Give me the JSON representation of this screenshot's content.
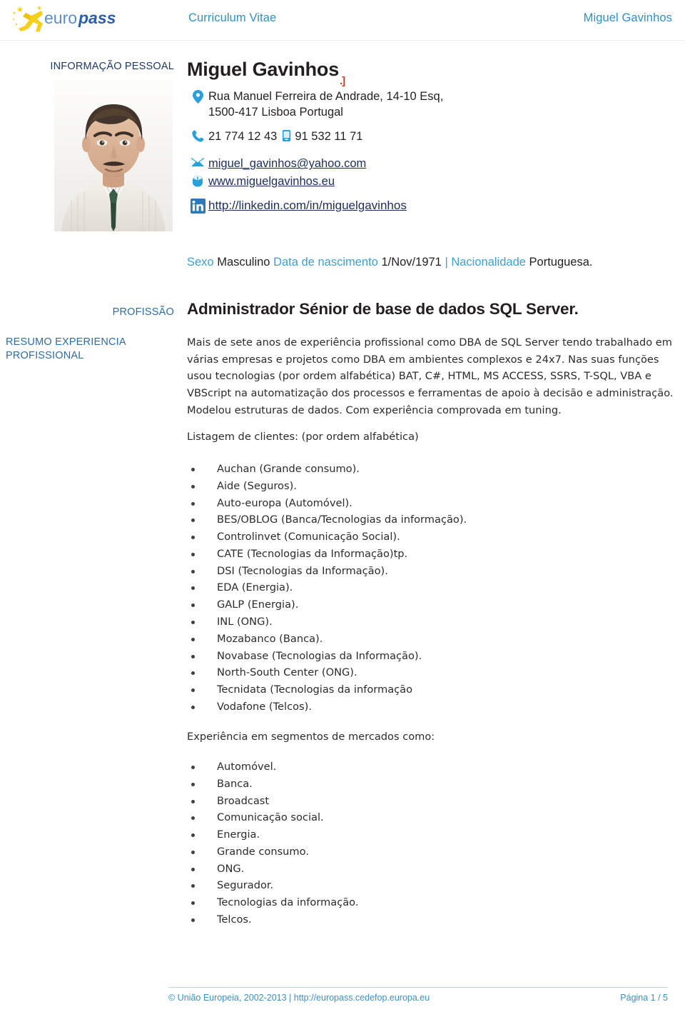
{
  "header": {
    "logo_text": "europass",
    "document_type": "Curriculum Vitae",
    "person_name": "Miguel Gavinhos"
  },
  "sidebar": {
    "personal_info_label": "INFORMAÇÃO PESSOAL",
    "profession_label": "PROFISSÃO",
    "summary_label": "RESUMO EXPERIENCIA PROFISSIONAL"
  },
  "personal": {
    "full_name": "Miguel Gavinhos",
    "red_mark": ".]",
    "address_line1": "Rua Manuel Ferreira de Andrade, 14-10 Esq,",
    "address_line2": "1500-417 Lisboa  Portugal",
    "phone_landline": "21 774 12 43",
    "phone_mobile": "91 532 11 71",
    "email": "miguel_gavinhos@yahoo.com",
    "website": "www.miguelgavinhos.eu",
    "linkedin": "http://linkedin.com/in/miguelgavinhos",
    "meta": {
      "sex_label": "Sexo",
      "sex_value": "Masculino",
      "birth_label": "Data de nascimento",
      "birth_value": "1/Nov/1971",
      "separator": "|",
      "nationality_label": "Nacionalidade",
      "nationality_value": "Portuguesa."
    }
  },
  "profession": {
    "title": "Administrador Sénior de base de dados SQL Server."
  },
  "summary": {
    "paragraph": "Mais de sete anos de experiência profissional como DBA de SQL Server tendo trabalhado em várias empresas e projetos como DBA em ambientes complexos e 24x7. Nas suas funções usou tecnologias (por ordem alfabética) BAT, C#, HTML, MS ACCESS, SSRS, T-SQL, VBA e VBScript na automatização dos processos e ferramentas de apoio à decisão e administração. Modelou estruturas de dados. Com experiência comprovada em tuning.",
    "clients_heading": "Listagem de clientes: (por ordem alfabética)",
    "clients": [
      "Auchan (Grande consumo).",
      "Aide (Seguros).",
      "Auto-europa (Automóvel).",
      "BES/OBLOG (Banca/Tecnologias da informação).",
      "Controlinvet (Comunicação Social).",
      "CATE (Tecnologias da Informação)tp.",
      "DSI (Tecnologias da Informação).",
      "EDA (Energia).",
      "GALP (Energia).",
      "INL (ONG).",
      "Mozabanco (Banca).",
      "Novabase (Tecnologias da Informação).",
      "North-South Center (ONG).",
      "Tecnidata (Tecnologias da informação",
      "Vodafone (Telcos)."
    ],
    "markets_heading": "Experiência em segmentos de mercados como:",
    "markets": [
      "Automóvel.",
      "Banca.",
      "Broadcast",
      "Comunicação social.",
      "Energia.",
      "Grande consumo.",
      "ONG.",
      "Segurador.",
      "Tecnologias da informação.",
      "Telcos."
    ]
  },
  "footer": {
    "copyright": "© União Europeia, 2002-2013 | http://europass.cedefop.europa.eu",
    "page_number": "Página 1 / 5"
  },
  "colors": {
    "accent_blue": "#2e93c7",
    "label_navy": "#1f3864",
    "link_navy": "#1c2d5e",
    "footer_blue": "#3d8fbf",
    "icon_blue": "#2b9fd8",
    "red_mark": "#d23b2e"
  }
}
